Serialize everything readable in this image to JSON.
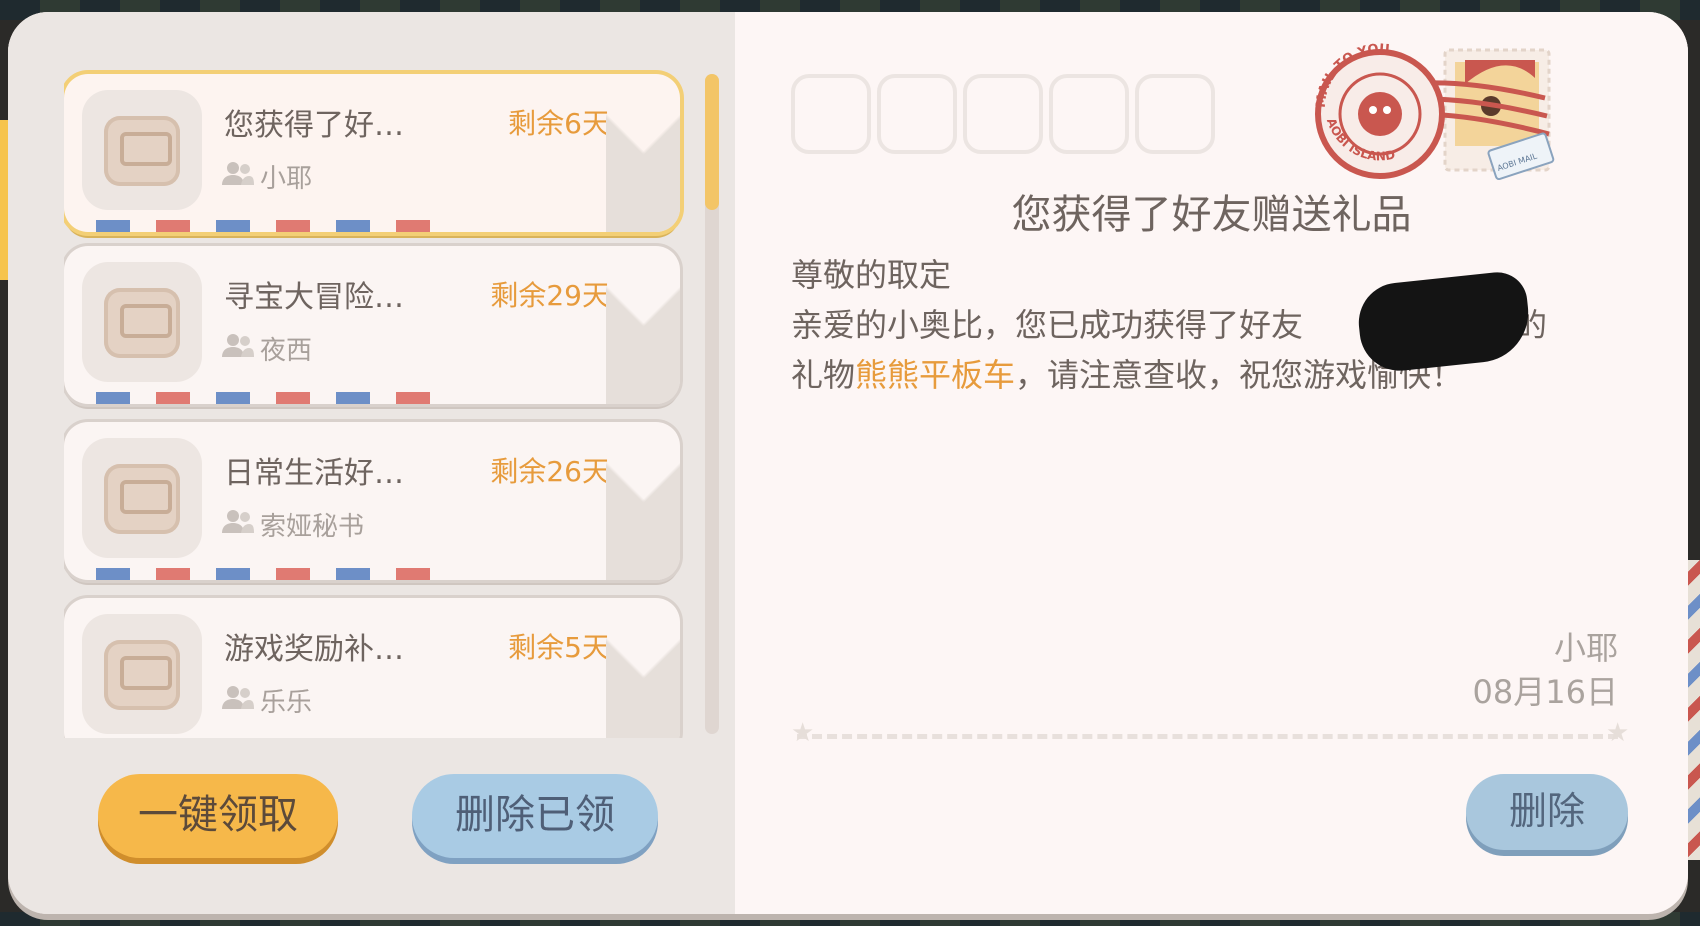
{
  "mail_list": [
    {
      "title": "您获得了好…",
      "remaining": "剩余6天",
      "sender": "小耶",
      "selected": true
    },
    {
      "title": "寻宝大冒险…",
      "remaining": "剩余29天",
      "sender": "夜西",
      "selected": false
    },
    {
      "title": "日常生活好…",
      "remaining": "剩余26天",
      "sender": "索娅秘书",
      "selected": false
    },
    {
      "title": "游戏奖励补…",
      "remaining": "剩余5天",
      "sender": "乐乐",
      "selected": false
    }
  ],
  "buttons": {
    "claim_all": "一键领取",
    "delete_claimed": "删除已领",
    "delete": "删除"
  },
  "letter": {
    "title": "您获得了好友赠送礼品",
    "greeting": "尊敬的取定",
    "line1_a": "亲爱的小奥比，您已成功获得了好友",
    "line1_b": "赠送的",
    "line2_a": "礼物",
    "gift_name": "熊熊平板车",
    "line2_b": "，请注意查收，祝您游戏愉快！",
    "signature": "小耶",
    "date": "08月16日"
  },
  "stamp": {
    "ring_text_top": "MAIL TO YOU",
    "ring_text_bottom": "AOBI ISLAND",
    "postmark_label": "AOBI MAIL"
  },
  "colors": {
    "accent_orange": "#e79b3c",
    "selected_border": "#f3cf76",
    "stamp_red": "#c9574f"
  }
}
